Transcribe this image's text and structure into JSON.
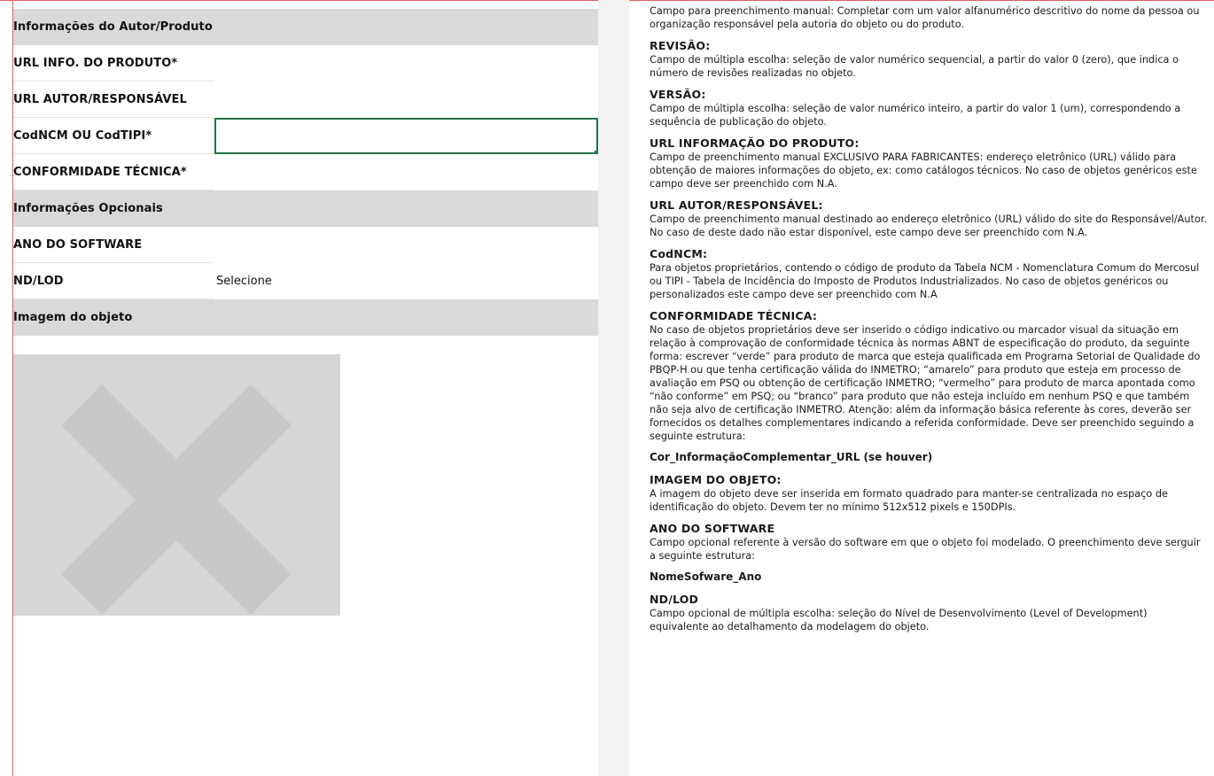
{
  "form": {
    "sections": {
      "autor_produto": "Informações do Autor/Produto",
      "opcionais": "Informações Opcionais",
      "imagem": "Imagem do objeto"
    },
    "fields": {
      "url_info_produto": "URL INFO. DO PRODUTO*",
      "url_autor": "URL AUTOR/RESPONSÁVEL",
      "codncm": "CodNCM OU CodTIPI*",
      "conformidade": "CONFORMIDADE TÉCNICA*",
      "ano_software": "ANO DO SOFTWARE",
      "nd_lod": "ND/LOD",
      "nd_lod_value": "Selecione"
    }
  },
  "doc": {
    "intro": "Campo para preenchimento manual: Completar com um valor alfanumérico descritivo do nome da pessoa ou organização responsável pela autoria do objeto ou do produto.",
    "revisao_h": "REVISÃO:",
    "revisao_t": "Campo de múltipla escolha: seleção de valor numérico sequencial, a partir do valor 0 (zero), que indica o número de revisões realizadas no objeto.",
    "versao_h": "VERSÃO:",
    "versao_t": "Campo de múltipla escolha: seleção de valor numérico inteiro, a partir do valor 1 (um), correspondendo a sequência de publicação do objeto.",
    "urlinfo_h": "URL INFORMAÇÃO DO PRODUTO:",
    "urlinfo_t": "Campo de preenchimento manual EXCLUSIVO PARA FABRICANTES: endereço eletrônico (URL) válido para obtenção de maiores informações do objeto, ex: como catálogos técnicos. No caso de objetos genéricos este campo deve ser preenchido com N.A.",
    "urlautor_h": "URL AUTOR/RESPONSÁVEL:",
    "urlautor_t": "Campo de preenchimento manual destinado ao endereço eletrônico (URL) válido do site do Responsável/Autor. No caso de deste dado não estar disponível, este campo deve ser preenchido com N.A.",
    "codncm_h": "CodNCM:",
    "codncm_t": "Para objetos proprietários, contendo o código de produto da Tabela NCM - Nomenclatura Comum do Mercosul ou TIPI - Tabela de Incidência do Imposto de Produtos Industrializados. No caso de objetos genéricos ou personalizados este campo deve ser preenchido com N.A",
    "conf_h": "CONFORMIDADE TÉCNICA:",
    "conf_t": "No caso de objetos proprietários deve ser inserido o código indicativo ou marcador visual da situação em relação à comprovação de conformidade técnica às normas ABNT de especificação do produto, da seguinte forma: escrever “verde” para produto de marca que esteja qualificada em Programa Setorial de Qualidade do PBQP-H ou que tenha certificação válida do INMETRO; “amarelo” para produto que esteja em processo de avaliação em PSQ ou obtenção de certificação INMETRO; “vermelho” para produto de marca apontada como “não conforme” em PSQ; ou “branco” para produto que não esteja incluído em nenhum PSQ e que também não seja alvo de certificação INMETRO. Atenção: além da informação básica referente às cores, deverão ser fornecidos os detalhes complementares indicando a referida conformidade. Deve ser preenchido seguindo a seguinte estrutura:",
    "conf_struct": "Cor_InformaçãoComplementar_URL (se houver)",
    "img_h": "IMAGEM DO OBJETO:",
    "img_t": "A imagem do objeto deve ser inserida em formato quadrado para manter-se centralizada no espaço de identificação do objeto. Devem ter no mínimo 512x512 pixels e 150DPIs.",
    "ano_h": "ANO DO SOFTWARE",
    "ano_t": "Campo opcional referente à versão do software em que o objeto foi modelado. O preenchimento deve serguir a seguinte estrutura:",
    "ano_struct": "NomeSofware_Ano",
    "ndlod_h": "ND/LOD",
    "ndlod_t": "Campo opcional de múltipla escolha: seleção do Nível de Desenvolvimento (Level of Development) equivalente ao detalhamento da modelagem do objeto."
  },
  "colors": {
    "section_bg": "#d9d9d9",
    "active_cell_border": "#217346",
    "page_border": "#e06060",
    "placeholder": "#d6d6d6",
    "placeholder_x": "#c8c8c8"
  },
  "icons": {
    "image_placeholder": "broken-image-x-icon"
  }
}
